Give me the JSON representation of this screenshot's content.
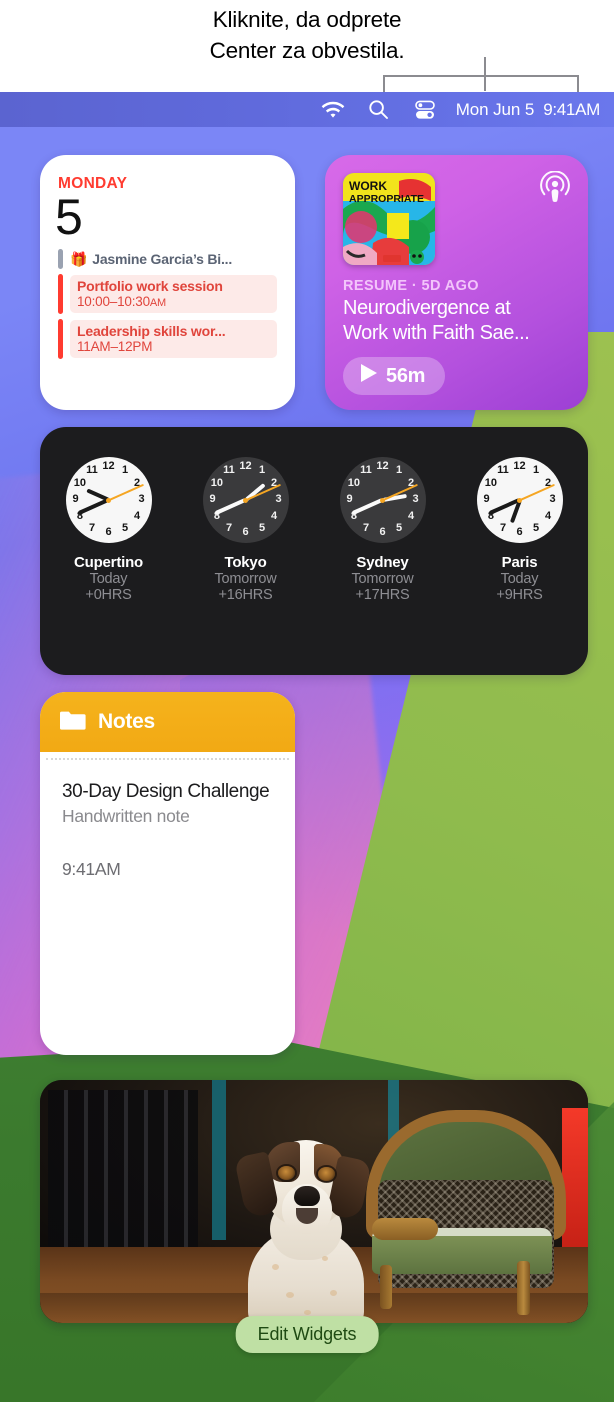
{
  "callout": {
    "line1": "Kliknite, da odprete",
    "line2": "Center za obvestila."
  },
  "menubar": {
    "icons": [
      "wifi-icon",
      "search-icon",
      "control-center-icon"
    ],
    "date": "Mon Jun 5",
    "time": "9:41AM"
  },
  "widgets": {
    "calendar": {
      "day_of_week": "MONDAY",
      "day_number": "5",
      "birthday": "Jasmine Garcia’s Bi...",
      "events": [
        {
          "title": "Portfolio work session",
          "start": "10:00–10:30",
          "meridiem": "AM"
        },
        {
          "title": "Leadership skills wor...",
          "start": "11AM–12PM",
          "meridiem": ""
        }
      ],
      "accent": "#ff3b30"
    },
    "podcast": {
      "artwork_title_1": "WORK",
      "artwork_title_2": "APPROPRIATE",
      "badge": "podcasts-icon",
      "meta": "RESUME · 5D AGO",
      "title_line1": "Neurodivergence at",
      "title_line2": "Work with Faith Sae...",
      "duration": "56m",
      "play_icon": "play-icon",
      "accent": "#c05ce0"
    },
    "clocks": [
      {
        "city": "Cupertino",
        "day": "Today",
        "offset": "+0HRS",
        "theme": "light",
        "hour_deg": 294,
        "minute_deg": 246,
        "second_deg": 66
      },
      {
        "city": "Tokyo",
        "day": "Tomorrow",
        "offset": "+16HRS",
        "theme": "dark",
        "hour_deg": 50,
        "minute_deg": 246,
        "second_deg": 66
      },
      {
        "city": "Sydney",
        "day": "Tomorrow",
        "offset": "+17HRS",
        "theme": "dark",
        "hour_deg": 80,
        "minute_deg": 246,
        "second_deg": 66
      },
      {
        "city": "Paris",
        "day": "Today",
        "offset": "+9HRS",
        "theme": "light",
        "hour_deg": 200,
        "minute_deg": 246,
        "second_deg": 66
      }
    ],
    "notes": {
      "header_title": "Notes",
      "folder_icon": "folder-icon",
      "note_title": "30-Day Design Challenge",
      "note_subtitle": "Handwritten note",
      "note_time": "9:41AM",
      "accent": "#f2a914"
    },
    "photo": {
      "alt": "dog sitting on wooden floor next to an antique cane armchair"
    }
  },
  "edit_widgets_label": "Edit Widgets",
  "clock_numerals": [
    "12",
    "1",
    "2",
    "3",
    "4",
    "5",
    "6",
    "7",
    "8",
    "9",
    "10",
    "11"
  ]
}
